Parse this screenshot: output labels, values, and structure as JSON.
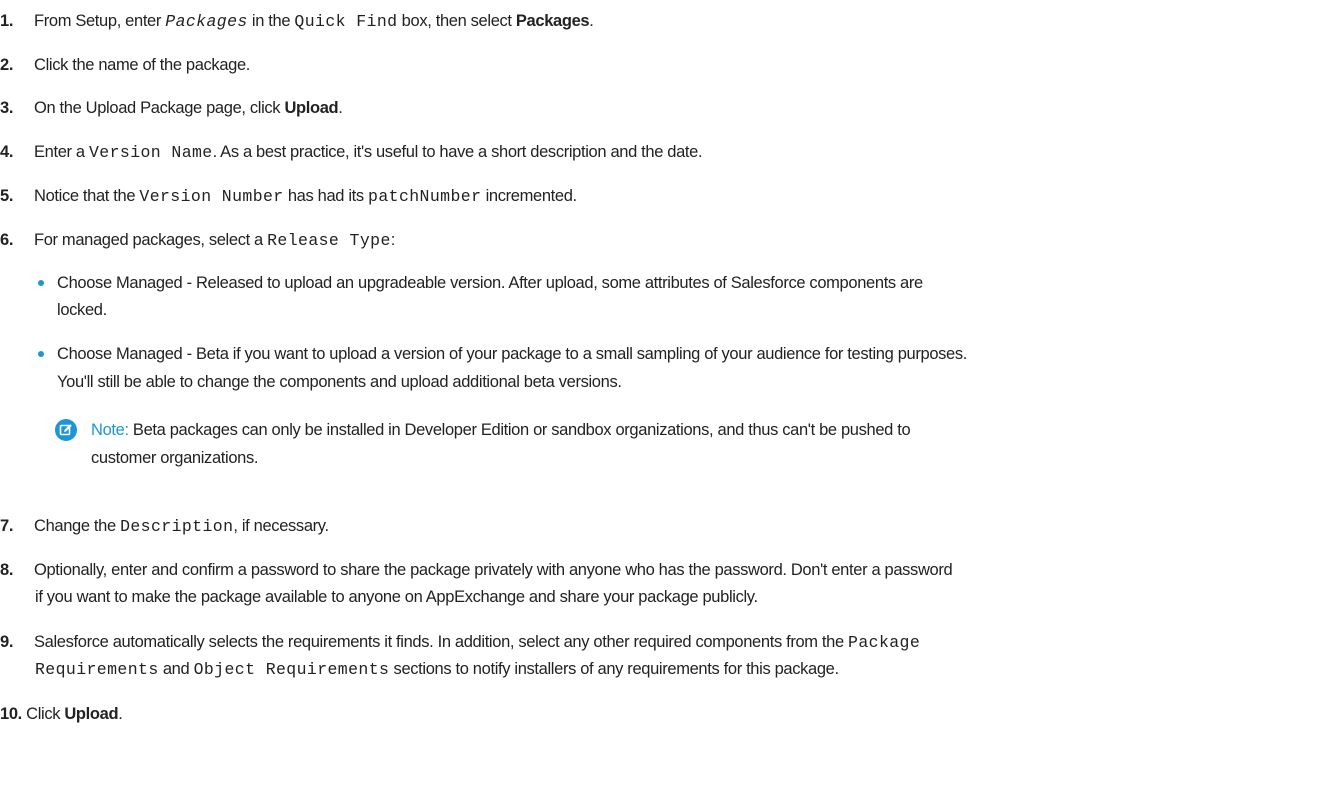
{
  "steps": [
    {
      "n": "1.",
      "t1": "From Setup, enter ",
      "c1": "Packages",
      "t2": " in the ",
      "c2": "Quick Find",
      "t3": " box, then select ",
      "b1": "Packages",
      "t4": "."
    },
    {
      "n": "2.",
      "t1": "Click the name of the package."
    },
    {
      "n": "3.",
      "t1": "On the Upload Package page, click ",
      "b1": "Upload",
      "t2": "."
    },
    {
      "n": "4.",
      "t1": "Enter a ",
      "c1": "Version Name",
      "t2": ". As a best practice, it's useful to have a short description and the date."
    },
    {
      "n": "5.",
      "t1": "Notice that the ",
      "c1": "Version Number",
      "t2": " has had its ",
      "c2": "patchNumber",
      "t3": " incremented."
    },
    {
      "n": "6.",
      "t1": "For managed packages, select a ",
      "c1": "Release Type",
      "t2": ":"
    },
    {
      "n": "7.",
      "t1": "Change the ",
      "c1": "Description",
      "t2": ", if necessary."
    },
    {
      "n": "8.",
      "l1": "Optionally, enter and confirm a password to share the package privately with anyone who has the password. Don't enter a password",
      "l2": "if you want to make the package available to anyone on AppExchange and share your package publicly."
    },
    {
      "n": "9.",
      "l1a": "Salesforce automatically selects the requirements it finds. In addition, select any other required components from the ",
      "c1": "Package",
      "c2": "Requirements",
      "l2a": " and ",
      "c3": "Object Requirements",
      "l2b": " sections to notify installers of any requirements for this package."
    },
    {
      "n": "10.",
      "t1": " Click ",
      "b1": "Upload",
      "t2": "."
    }
  ],
  "bullets": [
    {
      "l1": "Choose Managed - Released to upload an upgradeable version. After upload, some attributes of Salesforce components are",
      "l2": "locked."
    },
    {
      "l1": "Choose Managed - Beta if you want to upload a version of your package to a small sampling of your audience for testing purposes.",
      "l2": "You'll still be able to change the components and upload additional beta versions."
    }
  ],
  "note": {
    "label": "Note:",
    "l1": " Beta packages can only be installed in Developer Edition or sandbox organizations, and thus can't be pushed to",
    "l2": "customer organizations."
  },
  "colors": {
    "accent": "#1b96d6",
    "text": "#222222"
  },
  "icons": [
    "note-edit-icon",
    "bullet-dot"
  ]
}
